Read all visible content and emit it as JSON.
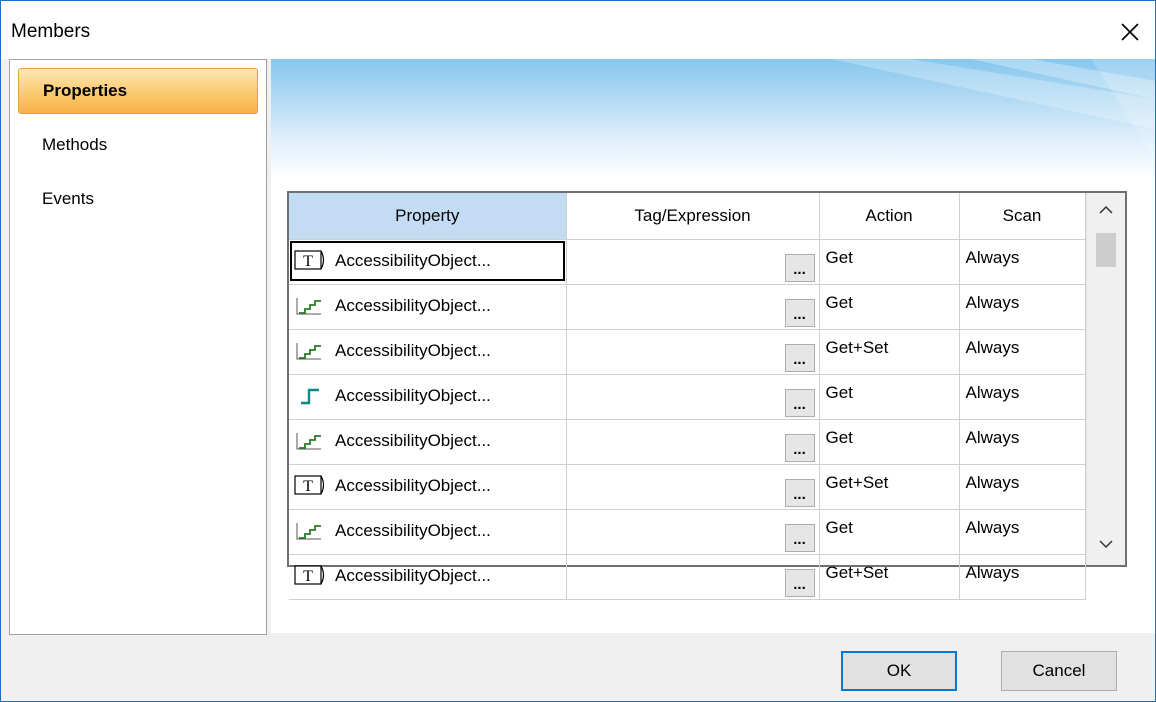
{
  "window": {
    "title": "Members"
  },
  "sidebar": {
    "items": [
      {
        "label": "Properties",
        "selected": true
      },
      {
        "label": "Methods",
        "selected": false
      },
      {
        "label": "Events",
        "selected": false
      }
    ]
  },
  "grid": {
    "columns": [
      "Property",
      "Tag/Expression",
      "Action",
      "Scan"
    ],
    "rows": [
      {
        "icon": "text-type-icon",
        "property": "AccessibilityObject...",
        "tag": "",
        "action": "Get",
        "scan": "Always"
      },
      {
        "icon": "analog-type-icon",
        "property": "AccessibilityObject...",
        "tag": "",
        "action": "Get",
        "scan": "Always"
      },
      {
        "icon": "analog-type-icon",
        "property": "AccessibilityObject...",
        "tag": "",
        "action": "Get+Set",
        "scan": "Always"
      },
      {
        "icon": "digital-type-icon",
        "property": "AccessibilityObject...",
        "tag": "",
        "action": "Get",
        "scan": "Always"
      },
      {
        "icon": "analog-type-icon",
        "property": "AccessibilityObject...",
        "tag": "",
        "action": "Get",
        "scan": "Always"
      },
      {
        "icon": "text-type-icon",
        "property": "AccessibilityObject...",
        "tag": "",
        "action": "Get+Set",
        "scan": "Always"
      },
      {
        "icon": "analog-type-icon",
        "property": "AccessibilityObject...",
        "tag": "",
        "action": "Get",
        "scan": "Always"
      },
      {
        "icon": "text-type-icon",
        "property": "AccessibilityObject...",
        "tag": "",
        "action": "Get+Set",
        "scan": "Always"
      }
    ],
    "browse_label": "..."
  },
  "buttons": {
    "ok": "OK",
    "cancel": "Cancel"
  },
  "colors": {
    "selected_header": "#c3dcf3",
    "nav_selected": "#fbcf7a",
    "default_button_border": "#0078d7"
  }
}
